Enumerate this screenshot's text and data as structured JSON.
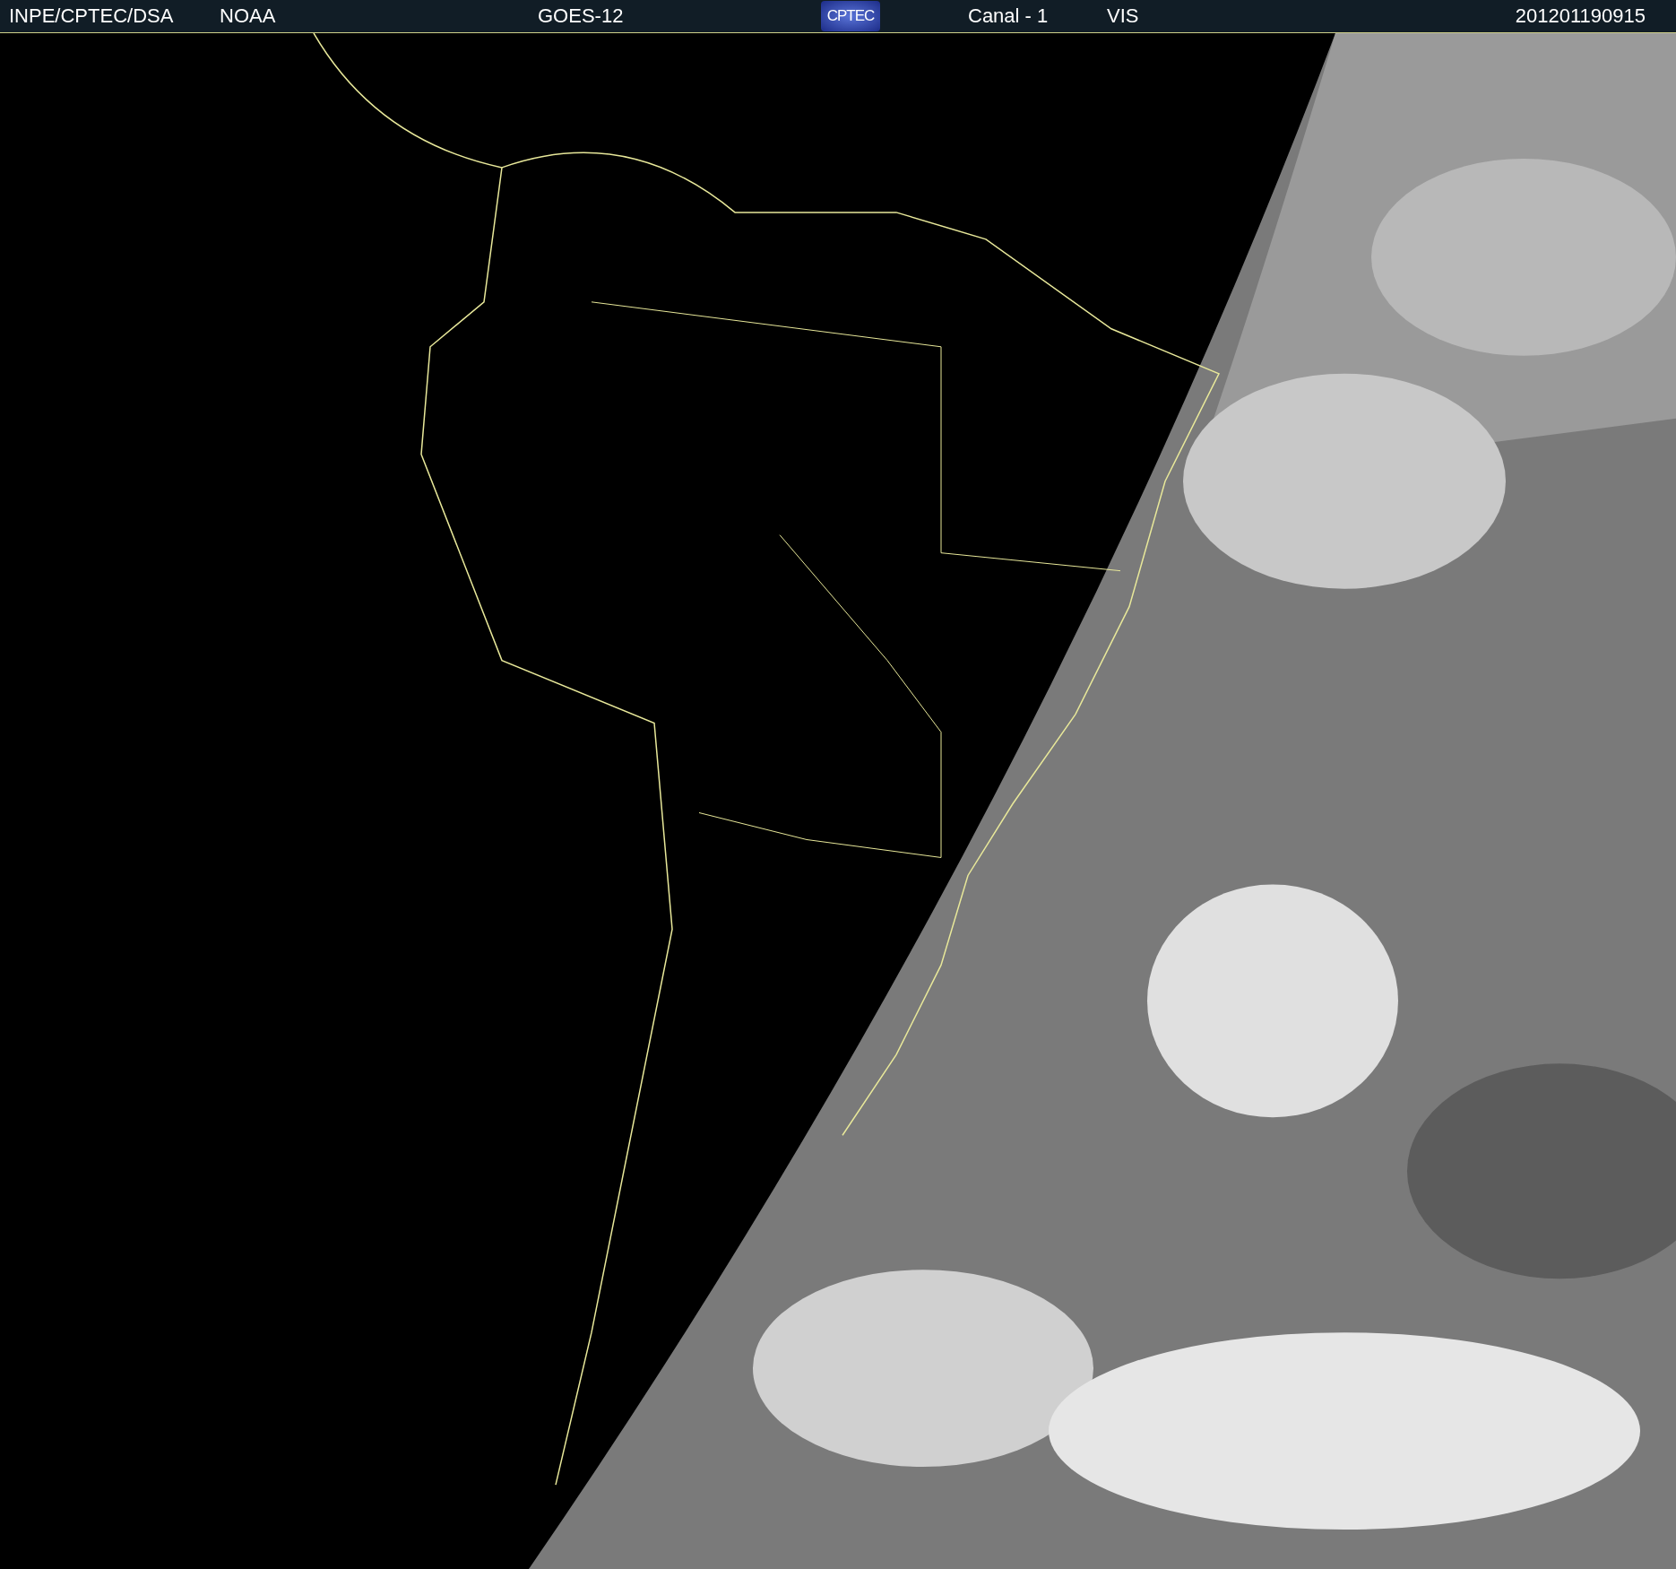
{
  "header": {
    "source": "INPE/CPTEC/DSA",
    "agency": "NOAA",
    "satellite": "GOES-12",
    "logo": "CPTEC",
    "channel": "Canal - 1",
    "band": "VIS",
    "timestamp": "201201190915"
  }
}
